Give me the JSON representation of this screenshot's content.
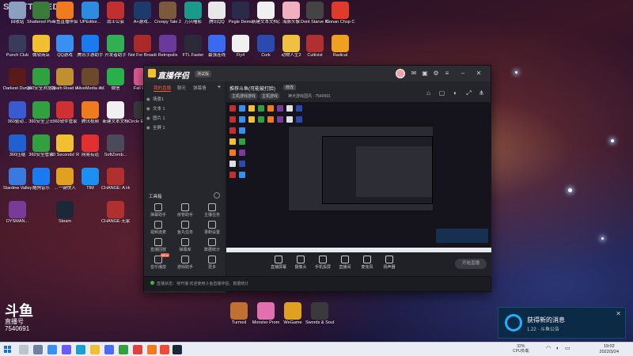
{
  "watermark": {
    "top": "SHATTERED",
    "logo": "斗鱼",
    "subtitle": "直播号",
    "room_id": "7540691"
  },
  "desktop_icons": [
    {
      "label": "回收站",
      "color": "#8aa0c0"
    },
    {
      "label": "Shattered Pixel Du...",
      "color": "#3a7a3a"
    },
    {
      "label": "斗鱼直播伴侣",
      "color": "#f07a1e"
    },
    {
      "label": "UPEditor...",
      "color": "#2d8be0"
    },
    {
      "label": "战士公会",
      "color": "#c03030"
    },
    {
      "label": "A+游戏...",
      "color": "#1b3c6a"
    },
    {
      "label": "Creepy Tale 2",
      "color": "#7a5a3a"
    },
    {
      "label": "万兴喵影",
      "color": "#1a9a8a"
    },
    {
      "label": "腾讯QQ",
      "color": "#e8e8e8"
    },
    {
      "label": "Pegle Demo",
      "color": "#2a2a4a"
    },
    {
      "label": "新建文本文档(3)",
      "color": "#f0f0f0"
    },
    {
      "label": "海豚头像",
      "color": "#f0b0c0"
    },
    {
      "label": "Dont Starve Rebuil...",
      "color": "#444"
    },
    {
      "label": "Conan Chop Chop",
      "color": "#e03a2a"
    },
    {
      "label": "Punch Club",
      "color": "#3a3a5a"
    },
    {
      "label": "微软商店",
      "color": "#f0c030"
    },
    {
      "label": "QQ游戏",
      "color": "#3a90f0"
    },
    {
      "label": "腾讯手游助手",
      "color": "#1a7af0"
    },
    {
      "label": "开发者助手",
      "color": "#30b050"
    },
    {
      "label": "Not For Broadcast",
      "color": "#aa2a2a"
    },
    {
      "label": "Retropolis",
      "color": "#6a3a9a"
    },
    {
      "label": "FTL Faster",
      "color": "#2a2a3a"
    },
    {
      "label": "最强连线",
      "color": "#3a6af0"
    },
    {
      "label": "Fly4",
      "color": "#f0f0f0"
    },
    {
      "label": "Cork",
      "color": "#2a4ab0"
    },
    {
      "label": "动物人生2",
      "color": "#f0c040"
    },
    {
      "label": "Cultivist",
      "color": "#b03030"
    },
    {
      "label": "Radical",
      "color": "#f0a020"
    },
    {
      "label": "Darkest Dungeon®",
      "color": "#5a1a1a"
    },
    {
      "label": "360安全浏览器",
      "color": "#30a040"
    },
    {
      "label": "Death Road to Canada",
      "color": "#c09030"
    },
    {
      "label": "AliveMedia 画C",
      "color": "#6a4a2a"
    },
    {
      "label": "微信",
      "color": "#2ab04a"
    },
    {
      "label": "Fall Gu...",
      "color": "#e05a90"
    },
    {
      "label": "360驱动...",
      "color": "#3a5ad0"
    },
    {
      "label": "360安全卫士",
      "color": "#30a040"
    },
    {
      "label": "360软件管家",
      "color": "#d03030"
    },
    {
      "label": "腾讯视频",
      "color": "#f07a1e"
    },
    {
      "label": "新建文本文档",
      "color": "#f0f0f0"
    },
    {
      "label": "Circle Empires",
      "color": "#3a3a3a"
    },
    {
      "label": "360压缩",
      "color": "#2060d0"
    },
    {
      "label": "360安全管家",
      "color": "#30a040"
    },
    {
      "label": "60 Seconds! Reatomized",
      "color": "#f0c030"
    },
    {
      "label": "网易有道",
      "color": "#e03030"
    },
    {
      "label": "SoftZomb...",
      "color": "#4a4a5a"
    },
    {
      "label": "Stardew Valley",
      "color": "#3a7ae0"
    },
    {
      "label": "酷狗音乐",
      "color": "#1a7af0"
    },
    {
      "label": "…一键快入",
      "color": "#e0a020"
    },
    {
      "label": "TIM",
      "color": "#1a90f0"
    },
    {
      "label": "CHANGE: A Homeless...",
      "color": "#b03030"
    },
    {
      "label": "DYSMAN...",
      "color": "#7a3a9a"
    },
    {
      "label": "Steam",
      "color": "#1b2838"
    },
    {
      "label": "CHANGE·无家可归的...",
      "color": "#b03030"
    }
  ],
  "window_icons": [
    {
      "label": "Turmoil",
      "color": "#c07030"
    },
    {
      "label": "Monster Prom",
      "color": "#e070b0"
    },
    {
      "label": "WeGame",
      "color": "#e0a020"
    },
    {
      "label": "Swords & Souls Ne...",
      "color": "#3a3a3a"
    }
  ],
  "app": {
    "name": "直播伴侣",
    "version": "测试版",
    "tabs": [
      "我的直播",
      "聊天",
      "弹幕墙"
    ],
    "scenes": [
      "场景1",
      "文本 1",
      "图片 1",
      "全屏 1"
    ],
    "tools_title": "工具箱",
    "tools": [
      {
        "label": "弹幕助手"
      },
      {
        "label": "房管助手"
      },
      {
        "label": "主播任务"
      },
      {
        "label": "视频连麦"
      },
      {
        "label": "鱼丸任务"
      },
      {
        "label": "录制设置"
      },
      {
        "label": "直播回放"
      },
      {
        "label": "弹幕库"
      },
      {
        "label": "数据统计"
      },
      {
        "label": "音乐播放"
      },
      {
        "label": "游戏助手"
      },
      {
        "label": "更多"
      }
    ],
    "stream_title": "推荐斗鱼(可能被打脸)",
    "edit_label": "修改",
    "tags": [
      "主机游戏游戏",
      "主机游戏"
    ],
    "meta": "神犬游戏国风 · 7540691",
    "bottom_buttons": [
      {
        "label": "直播屏幕"
      },
      {
        "label": "摄像头"
      },
      {
        "label": "手机投屏"
      },
      {
        "label": "直播间"
      },
      {
        "label": "麦克风"
      },
      {
        "label": "扬声器"
      }
    ],
    "start_live": "开始直播",
    "status_text": "直播状态：待开播   欢迎使用斗鱼直播伴侣，数据统计"
  },
  "toast": {
    "title": "获得新的消息",
    "body": "1.22 · 斗鱼公告"
  },
  "taskbar": {
    "cpu_percent": "32%",
    "cpu_label": "CPU负载",
    "time": "19:02",
    "date": "2022/3/24"
  }
}
